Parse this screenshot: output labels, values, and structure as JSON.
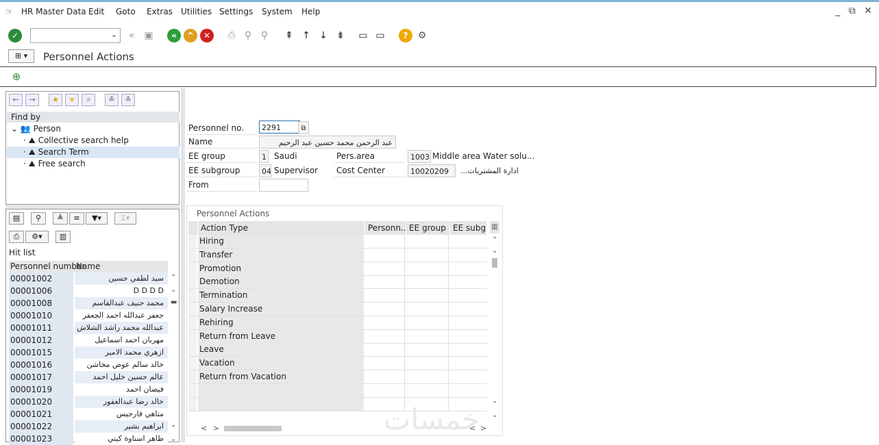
{
  "menubar": {
    "items": [
      "HR Master Data",
      "Edit",
      "Goto",
      "Extras",
      "Utilities",
      "Settings",
      "System",
      "Help"
    ],
    "window_controls": "_ ⧉ ✕"
  },
  "toolbar": {
    "command_value": "",
    "colors": {
      "ok": "#2e8b3a",
      "back": "#2e9e3a",
      "exit": "#e0a020",
      "cancel": "#d02020",
      "help": "#f0a800"
    }
  },
  "title": {
    "text": "Personnel Actions"
  },
  "left": {
    "find_by": "Find by",
    "tree": {
      "root": "Person",
      "items": [
        "Collective search help",
        "Search Term",
        "Free search"
      ]
    },
    "hit_list": {
      "label": "Hit list",
      "columns": [
        "Personnel number",
        "Name"
      ],
      "rows": [
        {
          "num": "00001002",
          "name": "سيد لطفي حسين"
        },
        {
          "num": "00001006",
          "name": "D D D D"
        },
        {
          "num": "00001008",
          "name": "محمد حنيف عبدالقاسم"
        },
        {
          "num": "00001010",
          "name": "جعفر عبدالله احمد الجعفر"
        },
        {
          "num": "00001011",
          "name": "عبدالله محمد راشد الشلاش"
        },
        {
          "num": "00001012",
          "name": "مهربان احمد اسماعيل"
        },
        {
          "num": "00001015",
          "name": "ازهري محمد الامير"
        },
        {
          "num": "00001016",
          "name": "خالد سالم عوض مخاشن"
        },
        {
          "num": "00001017",
          "name": "عالم حسين خليل احمد"
        },
        {
          "num": "00001019",
          "name": "فيضان احمد"
        },
        {
          "num": "00001020",
          "name": "خالد رضا عبدالغفور"
        },
        {
          "num": "00001021",
          "name": "متاهي فارجيس"
        },
        {
          "num": "00001022",
          "name": "ابراهيم بشير"
        },
        {
          "num": "00001023",
          "name": "طاهر استاوة كيتي"
        }
      ]
    }
  },
  "form": {
    "personnel_no_label": "Personnel no.",
    "personnel_no": "2291",
    "name_label": "Name",
    "name": "عبد الرحمن محمد حسين عبد الرحيم",
    "ee_group_label": "EE group",
    "ee_group_code": "1",
    "ee_group_text": "Saudi",
    "pers_area_label": "Pers.area",
    "pers_area_code": "1003",
    "pers_area_text": "Middle area Water solu...",
    "ee_subgroup_label": "EE subgroup",
    "ee_subgroup_code": "04",
    "ee_subgroup_text": "Supervisor",
    "cost_center_label": "Cost Center",
    "cost_center_code": "10020209",
    "cost_center_text": "...ادارة المشتريات",
    "from_label": "From",
    "from_value": ""
  },
  "actions": {
    "title": "Personnel Actions",
    "columns": [
      "Action Type",
      "Personn...",
      "EE group",
      "EE subg..."
    ],
    "rows": [
      "Hiring",
      "Transfer",
      "Promotion",
      "Demotion",
      "Termination",
      "Salary Increase",
      "Rehiring",
      "Return from Leave",
      "Leave",
      "Vacation",
      "Return from Vacation",
      "",
      ""
    ]
  },
  "watermark": "خمسات"
}
